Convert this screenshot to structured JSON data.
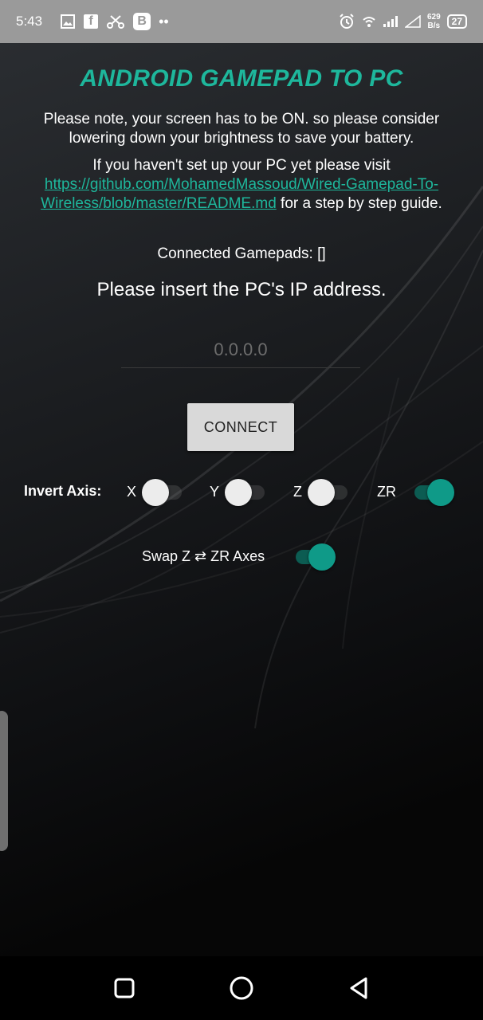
{
  "status_bar": {
    "time": "5:43",
    "left_icons": [
      "image-icon",
      "facebook-icon",
      "scissors-icon",
      "b-app-icon",
      "more-dots-icon"
    ],
    "facebook_glyph": "f",
    "b_glyph": "B",
    "dots": "••",
    "net_speed_value": "629",
    "net_speed_unit": "B/s",
    "battery": "27"
  },
  "app": {
    "title": "ANDROID GAMEPAD TO PC",
    "note": "Please note, your screen has to be ON. so please consider lowering down your brightness to save your battery.",
    "setup_prefix": "If you haven't set up your PC yet please visit",
    "setup_link": "https://github.com/MohamedMassoud/Wired-Gamepad-To-Wireless/blob/master/README.md",
    "setup_suffix": "for a step by step guide.",
    "connected_label": "Connected Gamepads:",
    "connected_value": "[]",
    "ip_prompt": "Please insert the PC's IP address.",
    "ip_placeholder": "0.0.0.0",
    "ip_value": "",
    "connect_label": "CONNECT",
    "invert_label": "Invert Axis:",
    "axes": [
      {
        "label": "X",
        "on": false
      },
      {
        "label": "Y",
        "on": false
      },
      {
        "label": "Z",
        "on": false
      },
      {
        "label": "ZR",
        "on": true
      }
    ],
    "swap_label": "Swap Z ⇄ ZR Axes",
    "swap_on": true
  },
  "colors": {
    "accent": "#1eb79c",
    "switch_on_thumb": "#0f9a88",
    "status_bar_bg": "#9a9a9a",
    "button_bg": "#d9d9d9"
  },
  "nav_bar": {
    "icons": [
      "recent-apps-icon",
      "home-icon",
      "back-icon"
    ]
  }
}
